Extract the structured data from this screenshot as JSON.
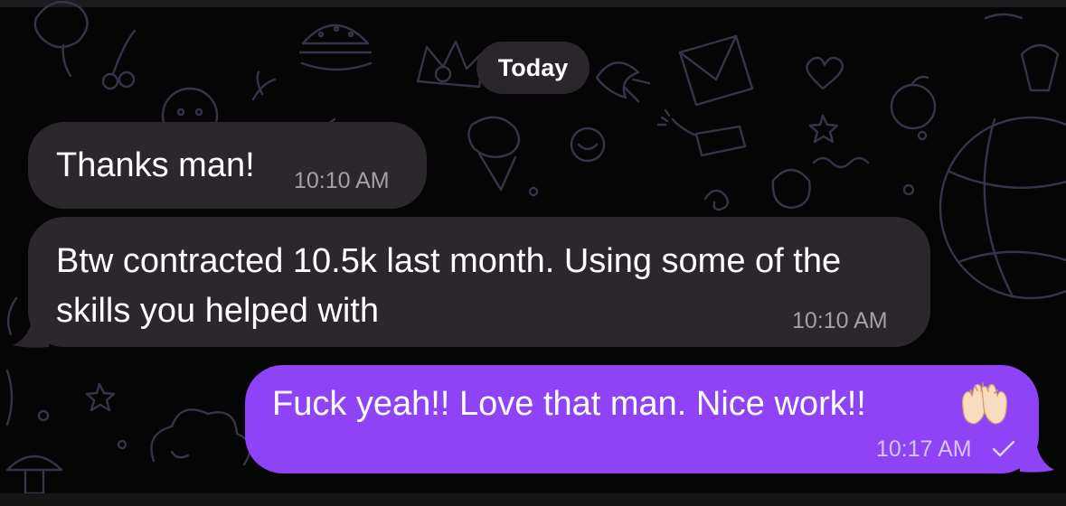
{
  "date_separator": "Today",
  "messages": [
    {
      "direction": "incoming",
      "text": "Thanks man!",
      "time": "10:10 AM"
    },
    {
      "direction": "incoming",
      "text": "Btw contracted 10.5k last month. Using some of the skills you helped with",
      "time": "10:10 AM"
    },
    {
      "direction": "outgoing",
      "text": "Fuck yeah!! Love that man. Nice work!!",
      "emoji": "raising-hands",
      "time": "10:17 AM",
      "status": "sent"
    }
  ],
  "colors": {
    "background": "#050505",
    "incoming_bubble": "#2c272d",
    "outgoing_bubble": "#8e44f6",
    "incoming_time": "#a59fa6",
    "outgoing_time": "#d7c4fb"
  },
  "icons": {
    "status": "check-icon",
    "emoji": "raising-hands-icon"
  }
}
